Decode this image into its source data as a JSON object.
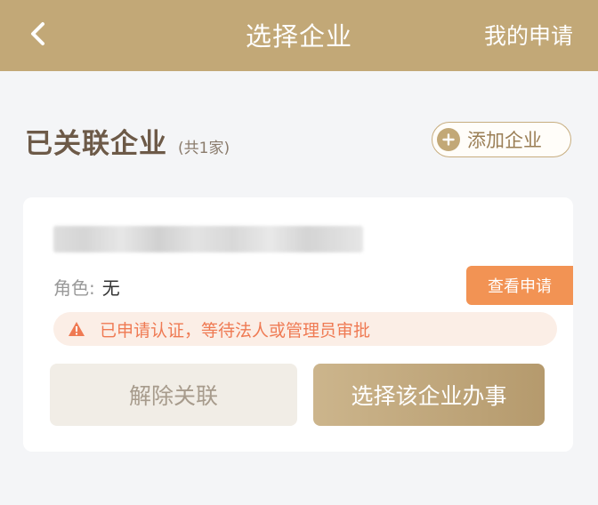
{
  "header": {
    "back_icon": "chevron-left-icon",
    "title": "选择企业",
    "right_action": "我的申请"
  },
  "section": {
    "title": "已关联企业",
    "count": "(共1家)"
  },
  "add_button": {
    "icon": "plus-circle-icon",
    "label": "添加企业"
  },
  "card": {
    "role_label": "角色:",
    "role_value": "无",
    "view_apply_label": "查看申请",
    "status_icon": "warning-icon",
    "status_text": "已申请认证，等待法人或管理员审批",
    "unlink_label": "解除关联",
    "choose_label": "选择该企业办事"
  },
  "colors": {
    "header_bg": "#c2a877",
    "accent_orange": "#f29354",
    "warning_text": "#ef7a53",
    "warning_bg": "#fbeee6",
    "page_bg": "#f4f5f7"
  }
}
